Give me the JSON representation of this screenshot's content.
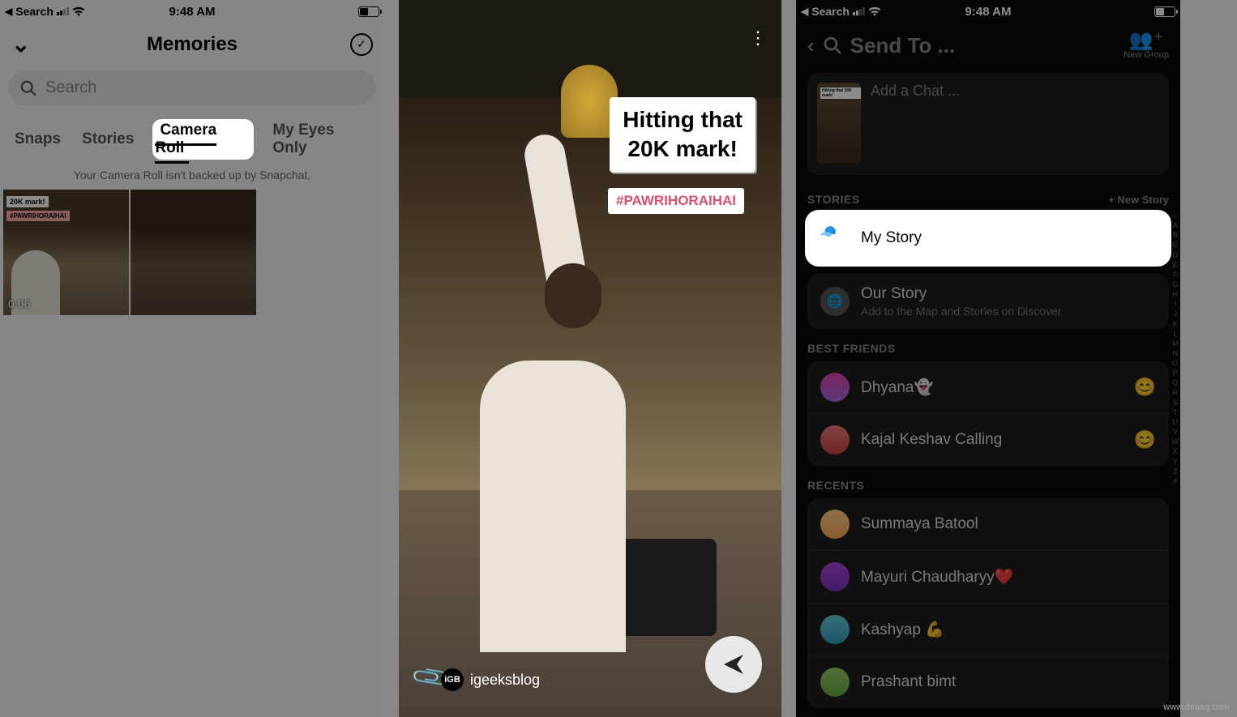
{
  "statusbar": {
    "back_app": "Search",
    "time": "9:48 AM"
  },
  "phone1": {
    "title": "Memories",
    "search_placeholder": "Search",
    "tabs": {
      "snaps": "Snaps",
      "stories": "Stories",
      "cameraroll": "Camera Roll",
      "myeyes": "My Eyes Only"
    },
    "note": "Your Camera Roll isn't backed up by Snapchat.",
    "thumb_caption1": "20K mark!",
    "thumb_caption2": "#PAWRIHORAIHAI",
    "duration": "0:06"
  },
  "phone2": {
    "caption_line1": "Hitting that",
    "caption_line2": "20K mark!",
    "hashtag": "#PAWRIHORAIHAI",
    "brand": "igeeksblog",
    "brand_badge": "iGB"
  },
  "phone3": {
    "sendto": "Send To ...",
    "newgroup": "New Group",
    "chat_placeholder": "Add a Chat ...",
    "sections": {
      "stories": "STORIES",
      "bestfriends": "BEST FRIENDS",
      "recents": "RECENTS"
    },
    "newstory": "+ New Story",
    "mystory": "My Story",
    "ourstory": "Our Story",
    "ourstory_sub": "Add to the Map and Stories on Discover",
    "friends": {
      "dhyana": "Dhyana👻",
      "kajal": "Kajal Keshav Calling"
    },
    "recents": {
      "summaya": "Summaya Batool",
      "mayuri": "Mayuri Chaudharyy❤️",
      "kashyap": "Kashyap 💪",
      "prashant": "Prashant bimt"
    },
    "alpha": [
      "☆",
      "A",
      "B",
      "C",
      "D",
      "E",
      "F",
      "G",
      "H",
      "I",
      "J",
      "K",
      "L",
      "M",
      "N",
      "O",
      "P",
      "Q",
      "R",
      "S",
      "T",
      "U",
      "V",
      "W",
      "X",
      "Y",
      "Z",
      "#"
    ]
  },
  "watermark": "www.deuaq.com"
}
